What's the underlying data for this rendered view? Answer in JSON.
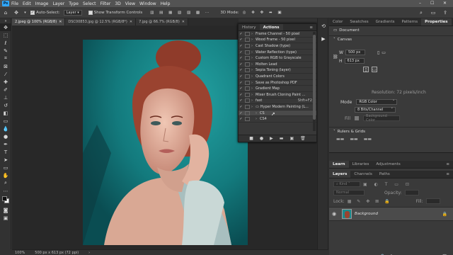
{
  "menubar": {
    "logo": "Ps",
    "items": [
      "File",
      "Edit",
      "Image",
      "Layer",
      "Type",
      "Select",
      "Filter",
      "3D",
      "View",
      "Window",
      "Help"
    ],
    "window_controls": [
      "–",
      "☐",
      "✕"
    ]
  },
  "options": {
    "auto_select_label": "Auto-Select:",
    "auto_select_value": "Layer",
    "show_transform_label": "Show Transform Controls",
    "mode_3d_label": "3D Mode:"
  },
  "doc_tabs": [
    {
      "label": "2.jpeg @ 100% (RGB/8)",
      "active": true
    },
    {
      "label": "DSC00853.jpg @ 12.5% (RGB/8*)",
      "active": false
    },
    {
      "label": "7.jpg @ 66.7% (RGB/8)",
      "active": false
    }
  ],
  "actions_panel": {
    "tabs": [
      "History",
      "Actions"
    ],
    "active_tab": "Actions",
    "items": [
      {
        "label": "Frame Channel - 50 pixel",
        "key": ""
      },
      {
        "label": "Wood Frame - 50 pixel",
        "key": ""
      },
      {
        "label": "Cast Shadow (type)",
        "key": ""
      },
      {
        "label": "Water Reflection (type)",
        "key": ""
      },
      {
        "label": "Custom RGB to Grayscale",
        "key": ""
      },
      {
        "label": "Molten Lead",
        "key": ""
      },
      {
        "label": "Sepia Toning (layer)",
        "key": ""
      },
      {
        "label": "Quadrant Colors",
        "key": ""
      },
      {
        "label": "Save as Photoshop PDF",
        "key": ""
      },
      {
        "label": "Gradient Map",
        "key": ""
      },
      {
        "label": "Mixer Brush Cloning Paint ...",
        "key": ""
      },
      {
        "label": "fast",
        "key": "Shft+F2"
      },
      {
        "label": "Hyper Modern Painting (L...",
        "key": "",
        "folder": true
      },
      {
        "label": "CS",
        "key": "",
        "highlight": true
      },
      {
        "label": "CS4",
        "key": ""
      }
    ],
    "footer_icons": [
      "■",
      "●",
      "▶",
      "▬",
      "▣",
      "🗑"
    ]
  },
  "status": {
    "zoom": "100%",
    "doc_info": "500 px x 613 px (72 ppi)"
  },
  "properties_panel": {
    "tabs": [
      "Color",
      "Swatches",
      "Gradients",
      "Patterns",
      "Properties"
    ],
    "active_tab": "Properties",
    "doc_label": "Document",
    "canvas_header": "Canvas",
    "w_label": "W",
    "h_label": "H",
    "w_value": "500 px",
    "h_value": "613 px",
    "resolution": "Resolution: 72 pixels/inch",
    "mode_label": "Mode",
    "mode_value": "RGB Color",
    "bits_value": "8 Bits/Channel",
    "fill_label": "Fill",
    "fill_value": "Background Color",
    "rulers_header": "Rulers & Grids"
  },
  "learn_panel": {
    "tabs": [
      "Learn",
      "Libraries",
      "Adjustments"
    ],
    "active_tab": "Learn"
  },
  "layers_panel": {
    "tabs": [
      "Layers",
      "Channels",
      "Paths"
    ],
    "active_tab": "Layers",
    "kind_label": "Kind",
    "blend_mode": "Normal",
    "opacity_label": "Opacity:",
    "lock_label": "Lock:",
    "fill_label": "Fill:",
    "layer_name": "Background",
    "footer_icons": [
      "🔗",
      "fx",
      "◑",
      "◐",
      "▣",
      "＋",
      "🗑"
    ]
  },
  "colors": {
    "photo_bg": "#1a8a8c",
    "ps_blue": "#31a8ff"
  }
}
